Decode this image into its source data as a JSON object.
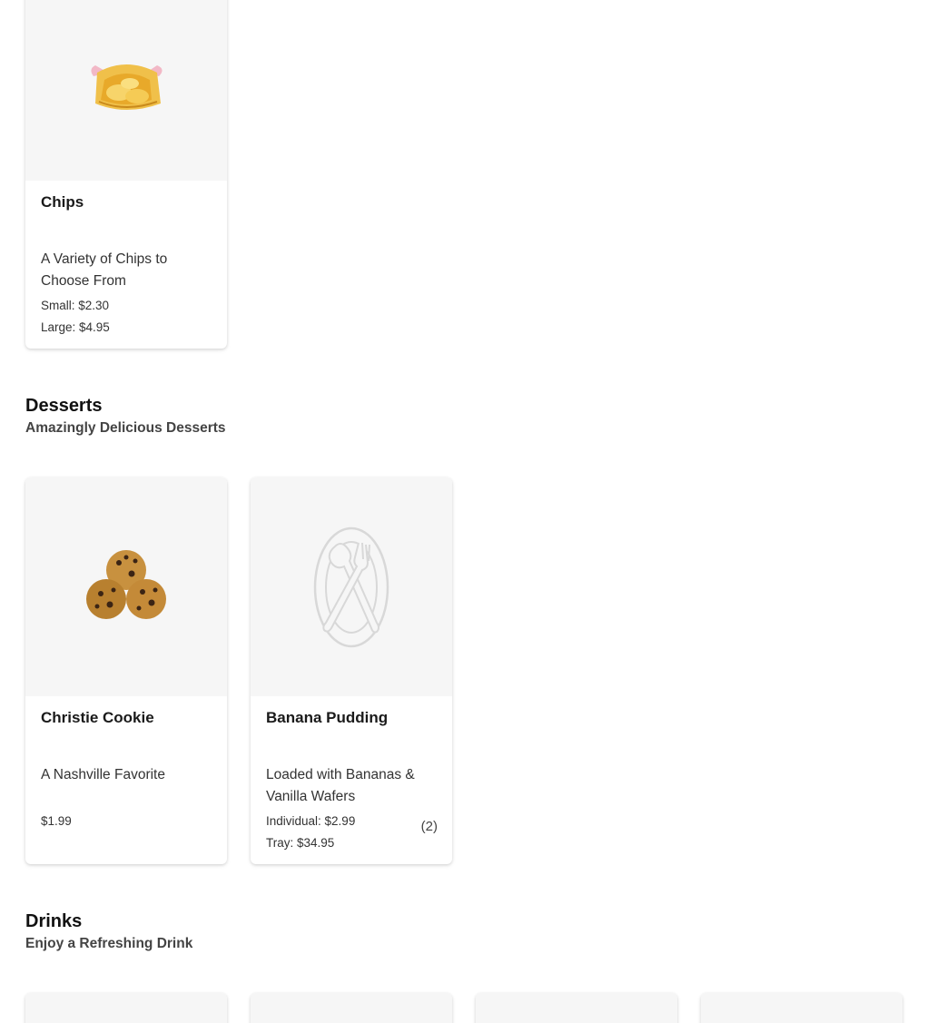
{
  "snacks": {
    "items": [
      {
        "name": "Chips",
        "description": "A Variety of Chips to Choose From",
        "prices": [
          "Small: $2.30",
          "Large: $4.95"
        ],
        "image": "chips-bag"
      }
    ]
  },
  "desserts": {
    "title": "Desserts",
    "subtitle": "Amazingly Delicious Desserts",
    "items": [
      {
        "name": "Christie Cookie",
        "description": "A Nashville Favorite",
        "prices": [
          "$1.99"
        ],
        "image": "cookies"
      },
      {
        "name": "Banana Pudding",
        "description": "Loaded with Bananas & Vanilla Wafers",
        "prices": [
          "Individual: $2.99",
          "Tray: $34.95"
        ],
        "count": "(2)",
        "image": "placeholder-plate-icon"
      }
    ]
  },
  "drinks": {
    "title": "Drinks",
    "subtitle": "Enjoy a Refreshing Drink",
    "items": [
      {
        "image": "drink-1"
      },
      {
        "image": "drink-2"
      },
      {
        "image": "drink-3"
      },
      {
        "image": "drink-4"
      }
    ]
  },
  "colors": {
    "card_bg": "#ffffff",
    "media_bg": "#f6f6f6",
    "text": "#1a1a1a",
    "subtext": "#444444"
  }
}
